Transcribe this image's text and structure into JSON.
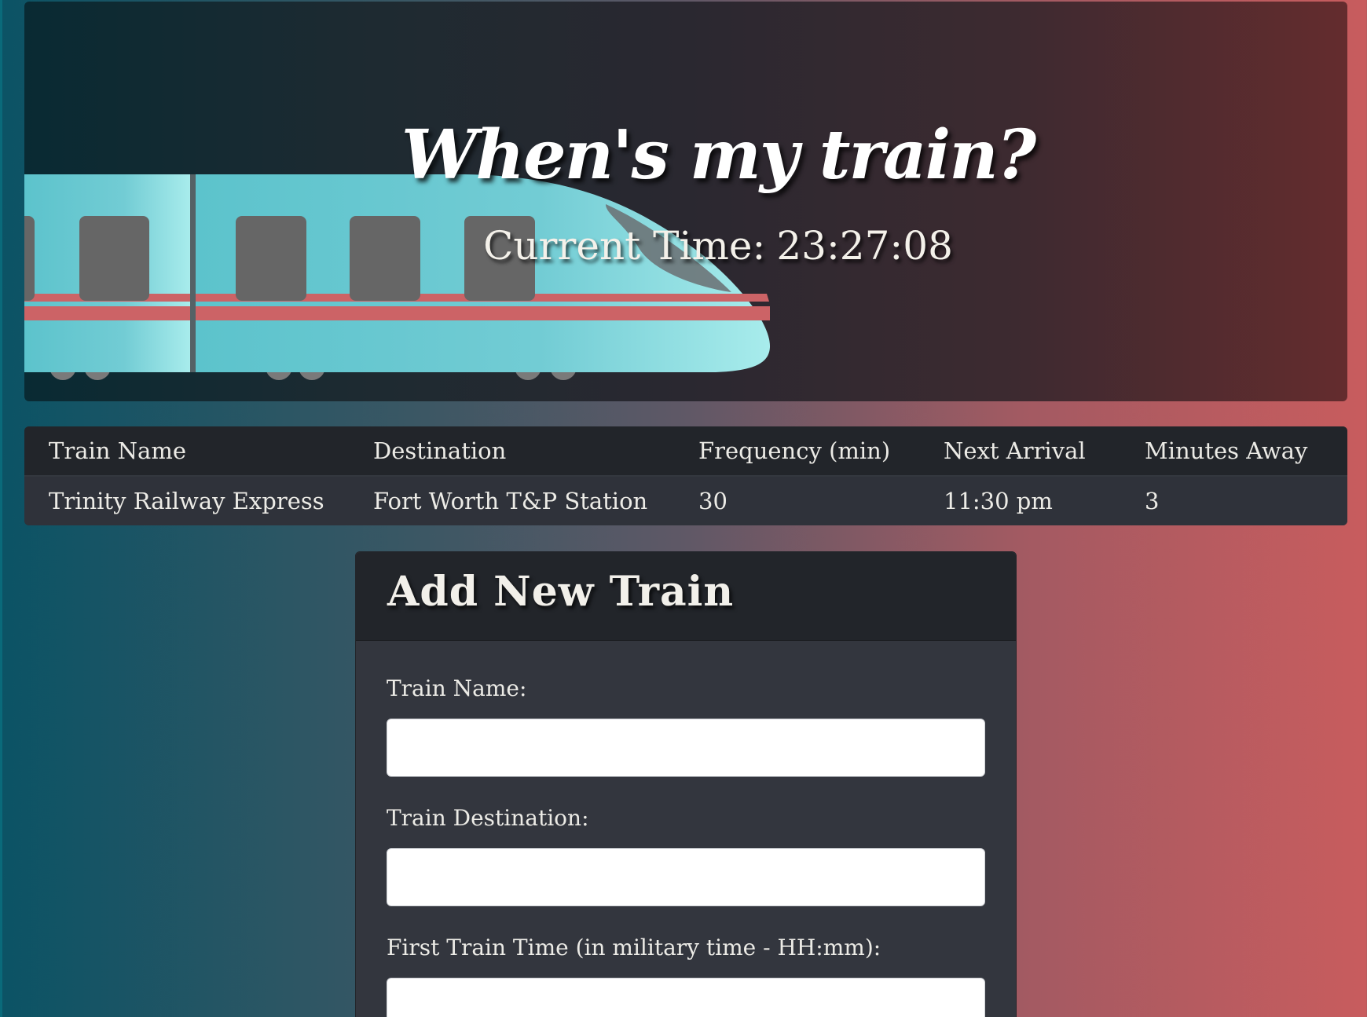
{
  "header": {
    "title": "When's my train?",
    "current_time_label": "Current Time:",
    "current_time_value": "23:27:08"
  },
  "schedule": {
    "columns": [
      "Train Name",
      "Destination",
      "Frequency (min)",
      "Next Arrival",
      "Minutes Away"
    ],
    "rows": [
      [
        "Trinity Railway Express",
        "Fort Worth T&P Station",
        "30",
        "11:30 pm",
        "3"
      ]
    ]
  },
  "add_train": {
    "title": "Add New Train",
    "fields": [
      {
        "label": "Train Name:",
        "value": "",
        "placeholder": ""
      },
      {
        "label": "Train Destination:",
        "value": "",
        "placeholder": ""
      },
      {
        "label": "First Train Time (in military time - HH:mm):",
        "value": "",
        "placeholder": ""
      }
    ]
  },
  "colors": {
    "train_body": "#6ecad0",
    "train_stripe": "#cc6366",
    "window": "#656565"
  }
}
